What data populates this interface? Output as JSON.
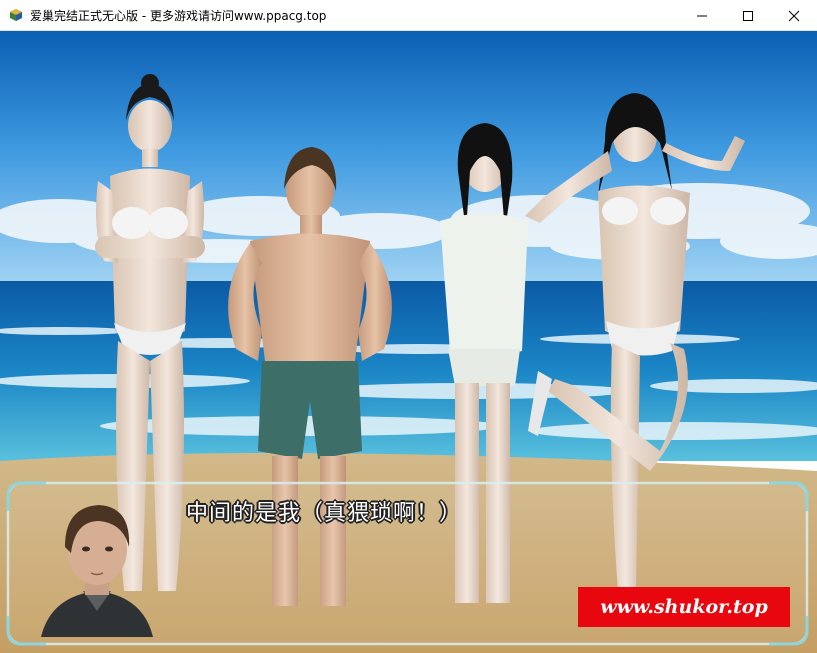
{
  "window": {
    "title": "爱巢完结正式无心版 - 更多游戏请访问www.ppacg.top",
    "icons": [
      "app-icon",
      "minimize-icon",
      "maximize-icon",
      "close-icon"
    ]
  },
  "scene": {
    "setting": "beach",
    "characters": [
      "woman-left",
      "man-center",
      "woman-towel",
      "woman-right"
    ]
  },
  "dialog": {
    "text": "中间的是我（真猥琐啊！）",
    "portrait": "speaker-portrait"
  },
  "watermark": {
    "text": "www.shukor.top",
    "color": "#e8070f"
  }
}
